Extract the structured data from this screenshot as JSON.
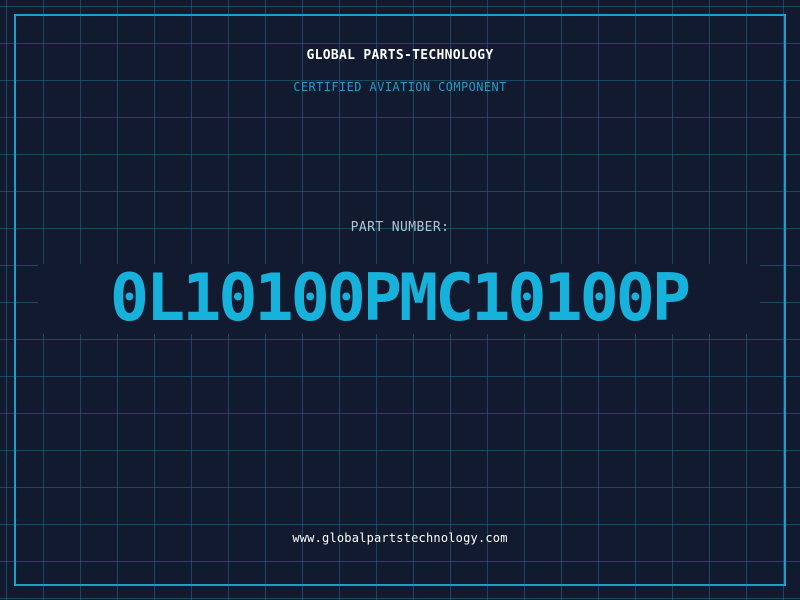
{
  "header": {
    "company": "GLOBAL PARTS-TECHNOLOGY",
    "tagline": "CERTIFIED AVIATION COMPONENT"
  },
  "part": {
    "label": "PART NUMBER:",
    "number": "0L10100PMC10100P"
  },
  "footer": {
    "url": "www.globalpartstechnology.com"
  },
  "colors": {
    "background": "#111a2e",
    "grid": "#206e8c",
    "frame": "#1a9fc7",
    "accent": "#17b2dc",
    "label": "#b7c2d0",
    "text": "#ffffff"
  }
}
